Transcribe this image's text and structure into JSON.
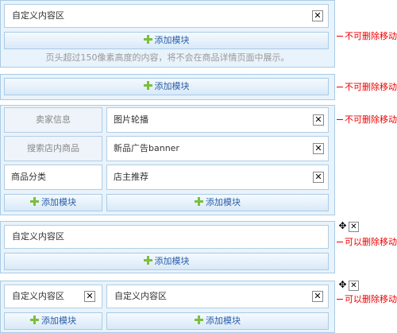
{
  "section1": {
    "custom_label": "自定义内容区",
    "add_label": "添加模块",
    "hint": "页头超过150像素高度的内容，将不会在商品详情页面中展示。",
    "note": "不可删除移动"
  },
  "section2": {
    "add_label": "添加模块",
    "note": "不可删除移动"
  },
  "section3": {
    "note": "不可删除移动",
    "left": [
      "卖家信息",
      "搜索店内商品",
      "商品分类"
    ],
    "right": [
      "图片轮播",
      "新品广告banner",
      "店主推荐"
    ],
    "add_left": "添加模块",
    "add_right": "添加模块"
  },
  "section4": {
    "custom_label": "自定义内容区",
    "add_label": "添加模块",
    "note": "可以删除移动"
  },
  "section5": {
    "left_label": "自定义内容区",
    "right_label": "自定义内容区",
    "add_left": "添加模块",
    "add_right": "添加模块",
    "note": "可以删除移动"
  },
  "icons": {
    "close": "close-icon",
    "move": "move-icon",
    "plus": "plus-icon"
  }
}
